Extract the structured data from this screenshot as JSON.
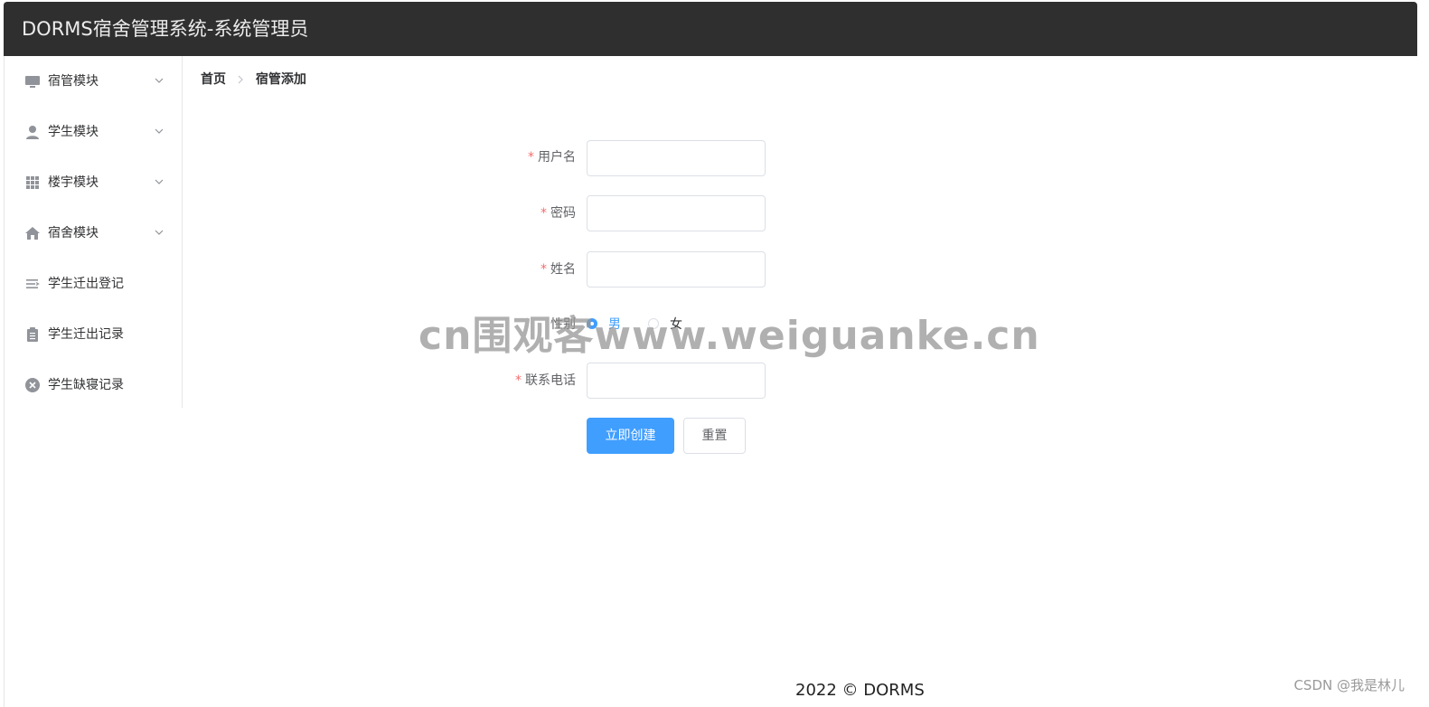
{
  "app": {
    "title": "DORMS宿舍管理系统-系统管理员"
  },
  "sidebar": {
    "items": [
      {
        "label": "宿管模块",
        "icon": "monitor-icon",
        "has_submenu": true
      },
      {
        "label": "学生模块",
        "icon": "user-icon",
        "has_submenu": true
      },
      {
        "label": "楼宇模块",
        "icon": "grid-icon",
        "has_submenu": true
      },
      {
        "label": "宿舍模块",
        "icon": "home-icon",
        "has_submenu": true
      },
      {
        "label": "学生迁出登记",
        "icon": "list-icon",
        "has_submenu": false
      },
      {
        "label": "学生迁出记录",
        "icon": "clipboard-icon",
        "has_submenu": false
      },
      {
        "label": "学生缺寝记录",
        "icon": "circle-close-icon",
        "has_submenu": false
      }
    ]
  },
  "breadcrumb": {
    "home": "首页",
    "current": "宿管添加"
  },
  "form": {
    "username_label": "用户名",
    "password_label": "密码",
    "name_label": "姓名",
    "gender_label": "性别",
    "gender_options": [
      "男",
      "女"
    ],
    "gender_selected": "男",
    "phone_label": "联系电话",
    "required_mark": "*",
    "submit_label": "立即创建",
    "reset_label": "重置"
  },
  "footer": {
    "text": "2022 © DORMS"
  },
  "overlays": {
    "watermark": "cn围观客www.weiguanke.cn",
    "csdn": "CSDN @我是林儿"
  },
  "colors": {
    "header_bg": "#2f2f2f",
    "primary": "#409eff",
    "required": "#f56c6c"
  }
}
